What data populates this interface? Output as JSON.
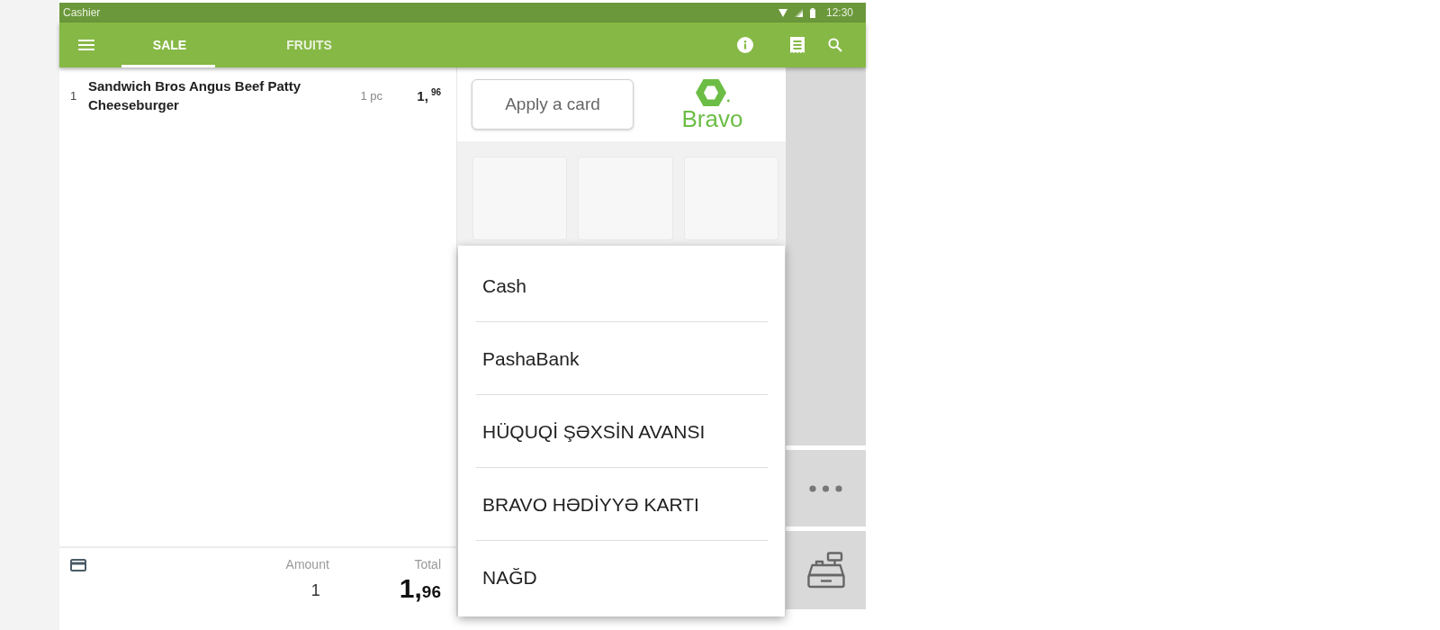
{
  "status_bar": {
    "title": "Cashier",
    "time": "12:30"
  },
  "toolbar": {
    "tabs": [
      {
        "label": "SALE",
        "selected": true
      },
      {
        "label": "FRUITS",
        "selected": false
      }
    ]
  },
  "order": {
    "items": [
      {
        "number": "1",
        "name": "Sandwich Bros Angus Beef Patty Cheeseburger",
        "quantity": "1 pc",
        "price": {
          "whole": "1,",
          "fraction": "96"
        }
      }
    ],
    "footer": {
      "amount_label": "Amount",
      "amount": "1",
      "total_label": "Total",
      "total": {
        "whole": "1,",
        "fraction": "96"
      }
    }
  },
  "card_panel": {
    "button": "Apply a card",
    "logo": "Bravo"
  },
  "payment_menu": {
    "items": [
      {
        "label": "Cash"
      },
      {
        "label": "PashaBank"
      },
      {
        "label": "HÜQUQİ ŞƏXSİN AVANSI"
      },
      {
        "label": "BRAVO HƏDİYYƏ KARTI"
      },
      {
        "label": "NAĞD"
      }
    ]
  }
}
